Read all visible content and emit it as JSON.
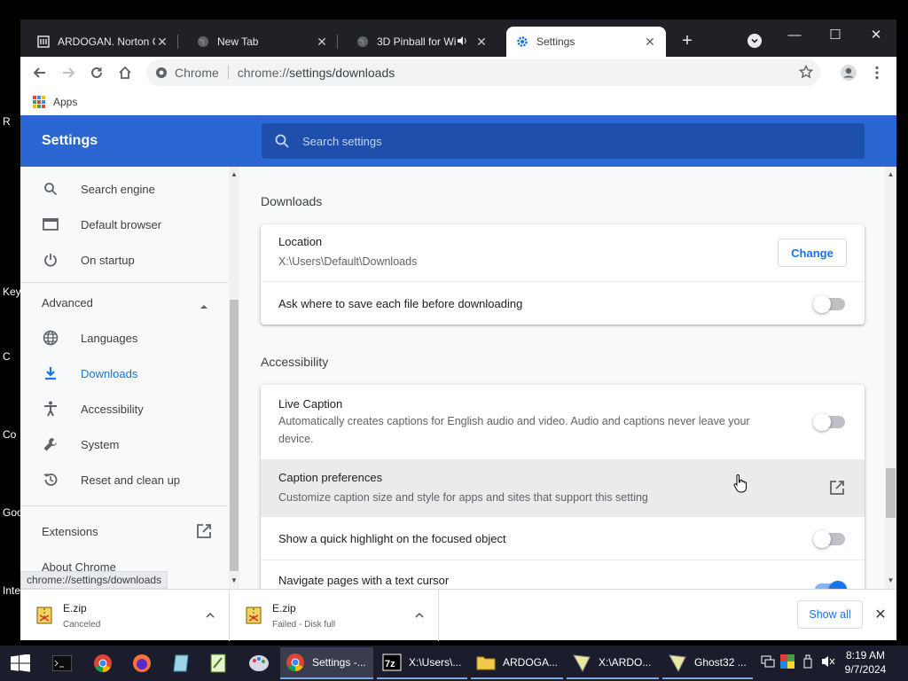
{
  "desktop": {
    "labels": [
      "R",
      "Key",
      "C",
      "Co",
      "Goo",
      "Inte"
    ]
  },
  "tabs": [
    {
      "title": "ARDOGAN. Norton G",
      "icon": "library-icon"
    },
    {
      "title": "New Tab",
      "icon": "globe-icon"
    },
    {
      "title": "3D Pinball for Wi",
      "icon": "globe-icon",
      "audio": true
    },
    {
      "title": "Settings",
      "icon": "gear-icon",
      "active": true
    }
  ],
  "window_controls": {
    "minimize": "—",
    "maximize": "☐",
    "close": "✕"
  },
  "omnibox": {
    "site_label": "Chrome",
    "url_host": "chrome://",
    "url_path": "settings/downloads"
  },
  "bookmarks": {
    "apps_label": "Apps"
  },
  "settings": {
    "title": "Settings",
    "search_placeholder": "Search settings"
  },
  "sidebar": {
    "items_top": [
      {
        "label": "Search engine",
        "icon": "search-icon"
      },
      {
        "label": "Default browser",
        "icon": "browser-window-icon"
      },
      {
        "label": "On startup",
        "icon": "power-icon"
      }
    ],
    "advanced_label": "Advanced",
    "items_advanced": [
      {
        "label": "Languages",
        "icon": "globe-icon"
      },
      {
        "label": "Downloads",
        "icon": "download-icon",
        "active": true
      },
      {
        "label": "Accessibility",
        "icon": "accessibility-icon"
      },
      {
        "label": "System",
        "icon": "wrench-icon"
      },
      {
        "label": "Reset and clean up",
        "icon": "restore-icon"
      }
    ],
    "extensions_label": "Extensions",
    "about_label": "About Chrome"
  },
  "downloads_section": {
    "title": "Downloads",
    "location_label": "Location",
    "location_value": "X:\\Users\\Default\\Downloads",
    "change_label": "Change",
    "ask_label": "Ask where to save each file before downloading",
    "ask_enabled": false
  },
  "accessibility_section": {
    "title": "Accessibility",
    "live_caption_label": "Live Caption",
    "live_caption_desc": "Automatically creates captions for English audio and video. Audio and captions never leave your device.",
    "live_caption_enabled": false,
    "caption_prefs_label": "Caption preferences",
    "caption_prefs_desc": "Customize caption size and style for apps and sites that support this setting",
    "highlight_label": "Show a quick highlight on the focused object",
    "highlight_enabled": false,
    "text_cursor_label": "Navigate pages with a text cursor",
    "text_cursor_enabled": true
  },
  "status_tip": "chrome://settings/downloads",
  "download_bar": {
    "items": [
      {
        "name": "E.zip",
        "status": "Canceled"
      },
      {
        "name": "E.zip",
        "status": "Failed - Disk full"
      }
    ],
    "show_all_label": "Show all"
  },
  "taskbar": {
    "tasks": [
      {
        "label": "Settings -...",
        "icon": "chrome-icon",
        "active": true
      },
      {
        "label": "X:\\Users\\...",
        "icon": "7zip-icon"
      },
      {
        "label": "ARDOGA...",
        "icon": "folder-icon"
      },
      {
        "label": "X:\\ARDO...",
        "icon": "ghost-icon"
      },
      {
        "label": "Ghost32 ...",
        "icon": "ghost-icon"
      }
    ],
    "clock_time": "8:19 AM",
    "clock_date": "9/7/2024"
  }
}
